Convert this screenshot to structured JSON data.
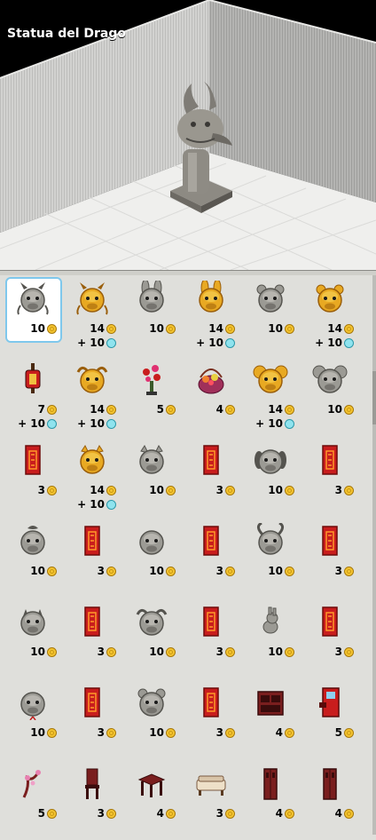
{
  "preview": {
    "title": "Statua del Drago"
  },
  "items": [
    {
      "name": "dragon-mask-icon",
      "credits": "10",
      "diamonds": "",
      "tone": "grey",
      "shape": "dragon",
      "selected": true
    },
    {
      "name": "golden-dragon-mask-icon",
      "credits": "14",
      "diamonds": "+ 10",
      "tone": "gold",
      "shape": "dragon"
    },
    {
      "name": "rabbit-mask-icon",
      "credits": "10",
      "diamonds": "",
      "tone": "grey",
      "shape": "rabbit"
    },
    {
      "name": "golden-rabbit-mask-icon",
      "credits": "14",
      "diamonds": "+ 10",
      "tone": "gold",
      "shape": "rabbit"
    },
    {
      "name": "tiger-mask-icon",
      "credits": "10",
      "diamonds": "",
      "tone": "grey",
      "shape": "tiger"
    },
    {
      "name": "golden-tiger-mask-icon",
      "credits": "14",
      "diamonds": "+ 10",
      "tone": "gold",
      "shape": "tiger"
    },
    {
      "name": "lantern-stand-icon",
      "credits": "7",
      "diamonds": "+ 10",
      "tone": "red",
      "shape": "lantern"
    },
    {
      "name": "golden-ox-mask-icon",
      "credits": "14",
      "diamonds": "+ 10",
      "tone": "gold",
      "shape": "ox"
    },
    {
      "name": "blossom-plant-icon",
      "credits": "5",
      "diamonds": "",
      "tone": "red",
      "shape": "plant"
    },
    {
      "name": "gift-basket-icon",
      "credits": "4",
      "diamonds": "",
      "tone": "red",
      "shape": "basket"
    },
    {
      "name": "golden-rat-mask-icon",
      "credits": "14",
      "diamonds": "+ 10",
      "tone": "gold",
      "shape": "rat"
    },
    {
      "name": "rat-mask-icon",
      "credits": "10",
      "diamonds": "",
      "tone": "grey",
      "shape": "rat"
    },
    {
      "name": "red-banner-icon",
      "credits": "3",
      "diamonds": "",
      "tone": "red",
      "shape": "banner"
    },
    {
      "name": "golden-pig-mask-icon",
      "credits": "14",
      "diamonds": "+ 10",
      "tone": "gold",
      "shape": "pig"
    },
    {
      "name": "pig-mask-icon",
      "credits": "10",
      "diamonds": "",
      "tone": "grey",
      "shape": "pig"
    },
    {
      "name": "red-banner-icon",
      "credits": "3",
      "diamonds": "",
      "tone": "red",
      "shape": "banner"
    },
    {
      "name": "dog-mask-icon",
      "credits": "10",
      "diamonds": "",
      "tone": "grey",
      "shape": "dog"
    },
    {
      "name": "red-banner-icon",
      "credits": "3",
      "diamonds": "",
      "tone": "red",
      "shape": "banner"
    },
    {
      "name": "rooster-mask-icon",
      "credits": "10",
      "diamonds": "",
      "tone": "grey",
      "shape": "rooster"
    },
    {
      "name": "red-banner-icon",
      "credits": "3",
      "diamonds": "",
      "tone": "red",
      "shape": "banner"
    },
    {
      "name": "monkey-mask-icon",
      "credits": "10",
      "diamonds": "",
      "tone": "grey",
      "shape": "monkey"
    },
    {
      "name": "red-banner-icon",
      "credits": "3",
      "diamonds": "",
      "tone": "red",
      "shape": "banner"
    },
    {
      "name": "goat-mask-icon",
      "credits": "10",
      "diamonds": "",
      "tone": "grey",
      "shape": "goat"
    },
    {
      "name": "red-banner-icon",
      "credits": "3",
      "diamonds": "",
      "tone": "red",
      "shape": "banner"
    },
    {
      "name": "horse-mask-icon",
      "credits": "10",
      "diamonds": "",
      "tone": "grey",
      "shape": "horse"
    },
    {
      "name": "red-banner-icon",
      "credits": "3",
      "diamonds": "",
      "tone": "red",
      "shape": "banner"
    },
    {
      "name": "ox-mask-icon",
      "credits": "10",
      "diamonds": "",
      "tone": "grey",
      "shape": "ox"
    },
    {
      "name": "red-banner-icon",
      "credits": "3",
      "diamonds": "",
      "tone": "red",
      "shape": "banner"
    },
    {
      "name": "rabbit-statue-icon",
      "credits": "10",
      "diamonds": "",
      "tone": "grey",
      "shape": "smallrabbit"
    },
    {
      "name": "red-banner-icon",
      "credits": "3",
      "diamonds": "",
      "tone": "red",
      "shape": "banner"
    },
    {
      "name": "snake-mask-icon",
      "credits": "10",
      "diamonds": "",
      "tone": "grey",
      "shape": "snake"
    },
    {
      "name": "red-banner-icon",
      "credits": "3",
      "diamonds": "",
      "tone": "red",
      "shape": "banner"
    },
    {
      "name": "tiger-mask-icon",
      "credits": "10",
      "diamonds": "",
      "tone": "grey",
      "shape": "tiger"
    },
    {
      "name": "red-banner-icon",
      "credits": "3",
      "diamonds": "",
      "tone": "red",
      "shape": "banner"
    },
    {
      "name": "cabinet-icon",
      "credits": "4",
      "diamonds": "",
      "tone": "wood",
      "shape": "cabinet"
    },
    {
      "name": "red-machine-icon",
      "credits": "5",
      "diamonds": "",
      "tone": "red",
      "shape": "machine"
    },
    {
      "name": "blossom-branch-icon",
      "credits": "5",
      "diamonds": "",
      "tone": "wood",
      "shape": "branch"
    },
    {
      "name": "chair-icon",
      "credits": "3",
      "diamonds": "",
      "tone": "wood",
      "shape": "chair"
    },
    {
      "name": "table-icon",
      "credits": "4",
      "diamonds": "",
      "tone": "wood",
      "shape": "table"
    },
    {
      "name": "sofa-icon",
      "credits": "3",
      "diamonds": "",
      "tone": "wood",
      "shape": "sofa"
    },
    {
      "name": "screen-divider-icon",
      "credits": "4",
      "diamonds": "",
      "tone": "wood",
      "shape": "divider"
    },
    {
      "name": "tall-screen-icon",
      "credits": "4",
      "diamonds": "",
      "tone": "wood",
      "shape": "divider"
    }
  ],
  "colors": {
    "selection": "#7fc8ec",
    "coin": "#f4c430",
    "diamond": "#8fe3ee",
    "grey": "#9b9a94",
    "gold": "#e8a922",
    "red": "#c81d1d",
    "wood": "#6e1a1a"
  }
}
